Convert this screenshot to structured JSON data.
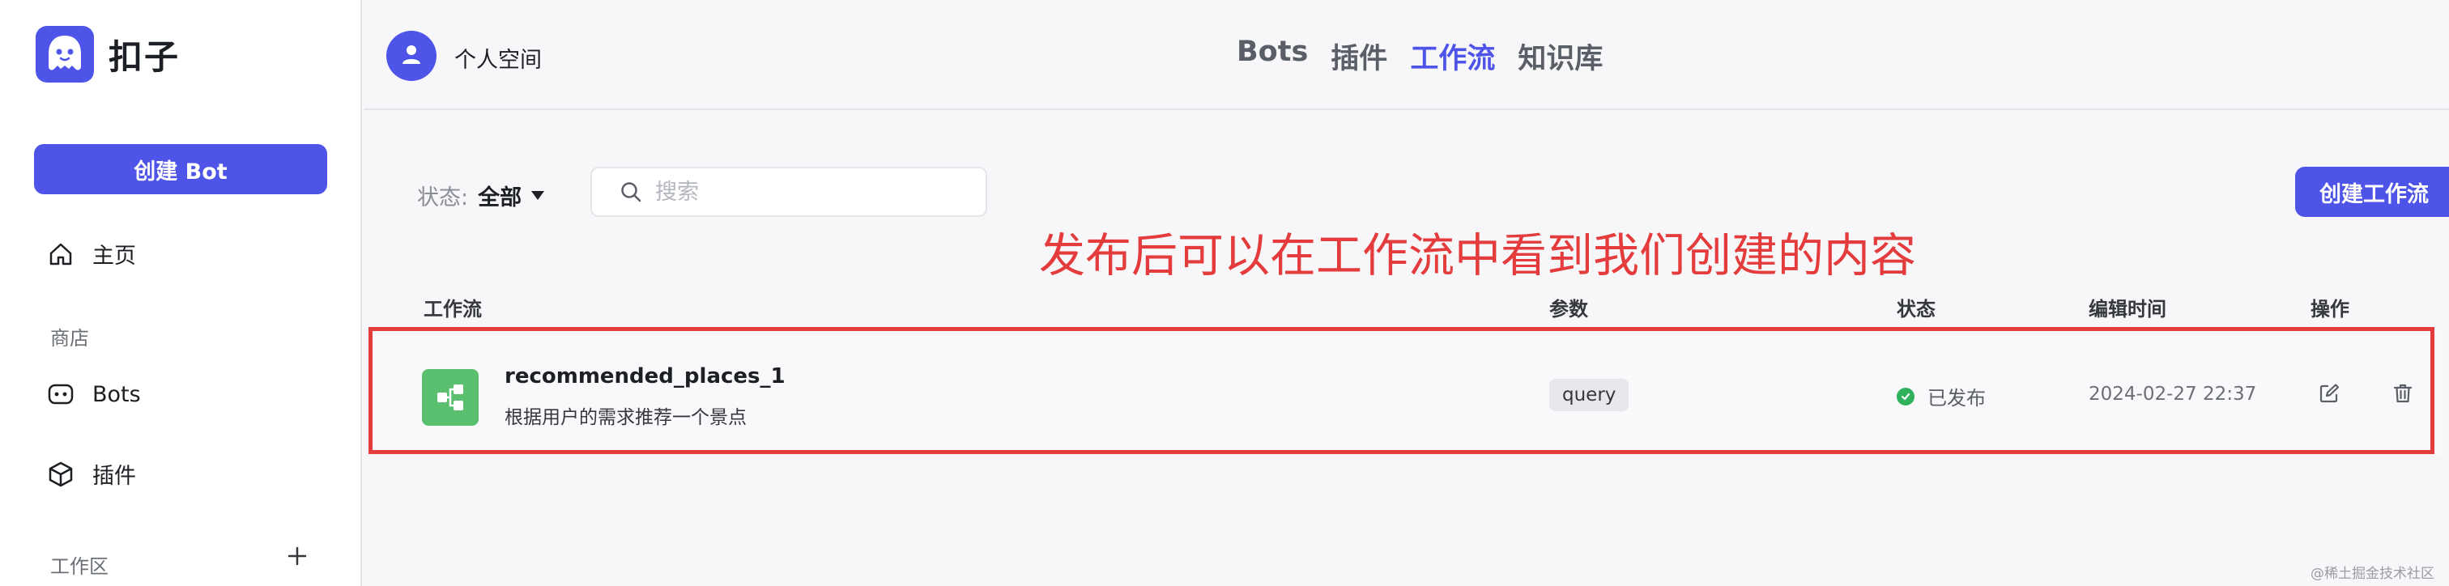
{
  "brand": {
    "name": "扣子"
  },
  "sidebar": {
    "create_bot_label": "创建 Bot",
    "home_label": "主页",
    "store_section": "商店",
    "bots_label": "Bots",
    "plugins_label": "插件",
    "workspace_section": "工作区"
  },
  "topbar": {
    "space_name": "个人空间",
    "tabs": [
      {
        "label": "Bots",
        "active": false
      },
      {
        "label": "插件",
        "active": false
      },
      {
        "label": "工作流",
        "active": true
      },
      {
        "label": "知识库",
        "active": false
      }
    ]
  },
  "toolbar": {
    "status_label": "状态:",
    "status_value": "全部",
    "search_placeholder": "搜索",
    "create_workflow_label": "创建工作流"
  },
  "annotation": "发布后可以在工作流中看到我们创建的内容",
  "table": {
    "headers": {
      "workflow": "工作流",
      "params": "参数",
      "status": "状态",
      "edit_time": "编辑时间",
      "actions": "操作"
    },
    "rows": [
      {
        "name": "recommended_places_1",
        "description": "根据用户的需求推荐一个景点",
        "param": "query",
        "status": "已发布",
        "edit_time": "2024-02-27 22:37"
      }
    ]
  },
  "watermark": "@稀土掘金技术社区",
  "colors": {
    "accent": "#4f54e8",
    "annotation": "#e43c3c",
    "published": "#2fb25b",
    "workflow_icon": "#5ac06f"
  },
  "icons": [
    "coze-logo-icon",
    "home-icon",
    "bot-icon",
    "cube-icon",
    "plus-icon",
    "user-icon",
    "search-icon",
    "workflow-icon",
    "check-icon",
    "edit-icon",
    "trash-icon"
  ]
}
